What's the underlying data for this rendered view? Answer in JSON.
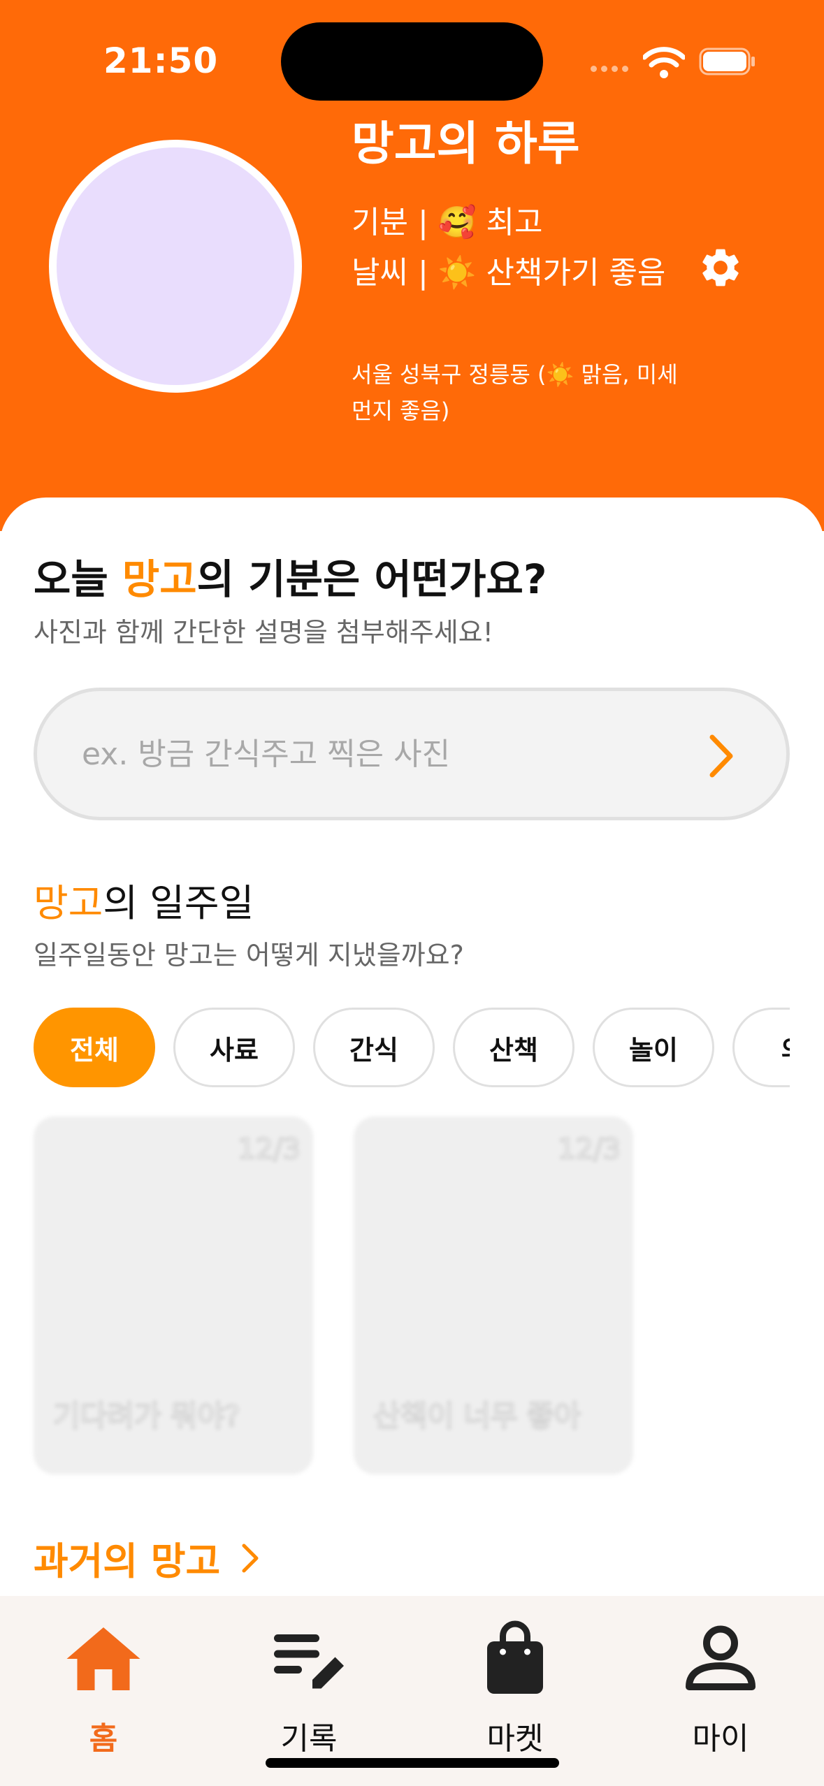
{
  "status_bar": {
    "time": "21:50"
  },
  "profile": {
    "pet_name": "망고의 하루",
    "mood": "기분 | 🥰 최고",
    "weather": "날씨 | ☀️ 산책가기 좋음",
    "location": "서울 성북구 정릉동 (☀️ 맑음, 미세먼지 좋음)"
  },
  "mood_prompt": {
    "title_before": "오늘 ",
    "title_highlight": "망고",
    "title_after": "의 기분은 어떤가요?",
    "subtitle": "사진과 함께 간단한 설명을 첨부해주세요!",
    "input_placeholder": "ex. 방금 간식주고 찍은 사진",
    "input_value": ""
  },
  "week": {
    "title_highlight": "망고",
    "title_after": "의 일주일",
    "subtitle": "일주일동안 망고는 어떻게 지냈을까요?",
    "filters": [
      "전체",
      "사료",
      "간식",
      "산책",
      "놀이",
      "의"
    ],
    "selected_filter": "전체",
    "cards": [
      {
        "date": "12/3",
        "caption": "기다려가 뭐야?"
      },
      {
        "date": "12/3",
        "caption": "산책이 너무 좋아"
      }
    ]
  },
  "past": {
    "label": "과거의 망고"
  },
  "tabbar": {
    "selected": "홈",
    "items": [
      {
        "label": "홈",
        "icon": "home-icon"
      },
      {
        "label": "기록",
        "icon": "note-edit-icon"
      },
      {
        "label": "마켓",
        "icon": "shopping-bag-icon"
      },
      {
        "label": "마이",
        "icon": "person-icon"
      }
    ]
  },
  "colors": {
    "header": "#FF6A08",
    "accent": "#FF8A00",
    "chip_active": "#FF9500",
    "avatar": "#E9DDFD",
    "tabbar_bg": "#F9F4F1",
    "tab_active": "#F26A1B"
  }
}
